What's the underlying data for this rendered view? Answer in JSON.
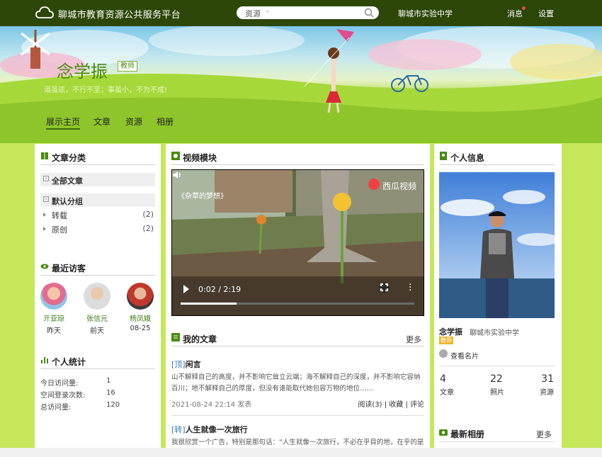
{
  "header": {
    "site_title": "聊城市教育资源公共服务平台",
    "search_type": "资源",
    "search_placeholder": "",
    "school": "聊城市实验中学",
    "messages": "消息",
    "settings": "设置"
  },
  "profile": {
    "name": "念学振",
    "role": "教师",
    "motto": "道虽迩，不行不至；事虽小，不为不成!"
  },
  "nav": [
    "展示主页",
    "文章",
    "资源",
    "相册"
  ],
  "categories": {
    "title": "文章分类",
    "all": "全部文章",
    "group": "默认分组",
    "items": [
      {
        "label": "转载",
        "count": "(2)"
      },
      {
        "label": "原创",
        "count": "(2)"
      }
    ]
  },
  "visitors": {
    "title": "最近访客",
    "items": [
      {
        "name": "亓亚琼",
        "date": "昨天"
      },
      {
        "name": "张信元",
        "date": "前天"
      },
      {
        "name": "杨凤娥",
        "date": "08-25"
      }
    ]
  },
  "stats": {
    "title": "个人统计",
    "rows": [
      {
        "label": "今日访问量:",
        "value": "1"
      },
      {
        "label": "空间登录次数:",
        "value": "16"
      },
      {
        "label": "总访问量:",
        "value": "120"
      }
    ]
  },
  "video": {
    "section_title": "视频模块",
    "title": "《杂草的梦想》",
    "brand": "西瓜视频",
    "time": "0:02 / 2:19",
    "progress_fraction": 0.24
  },
  "articles": {
    "title": "我的文章",
    "more": "更多",
    "items": [
      {
        "tag": "[顶]",
        "title": "闲言",
        "summary": "山不解释自己的高度，并不影响它耸立云端；海不解释自己的深度，并不影响它容纳百川；地不解释自己的厚度，但没有谁能取代她包容万物的地位……",
        "date": "2021-08-24 22:14 发表",
        "actions": "阅读(3) | 收藏 | 评论"
      },
      {
        "tag": "[转]",
        "title": "人生就像一次旅行",
        "summary": "我很欣赏一个广告，特别是那句话：“人生就像一次旅行，不必在乎目的地，在乎的是"
      }
    ]
  },
  "info": {
    "title": "个人信息",
    "name": "念学振",
    "school": "聊城市实验中学",
    "badge": "教师",
    "card_link": "查看名片",
    "stats": [
      {
        "value": "4",
        "label": "文章"
      },
      {
        "value": "22",
        "label": "照片"
      },
      {
        "value": "31",
        "label": "资源"
      }
    ]
  },
  "albums": {
    "title": "最新相册",
    "more": "更多"
  }
}
